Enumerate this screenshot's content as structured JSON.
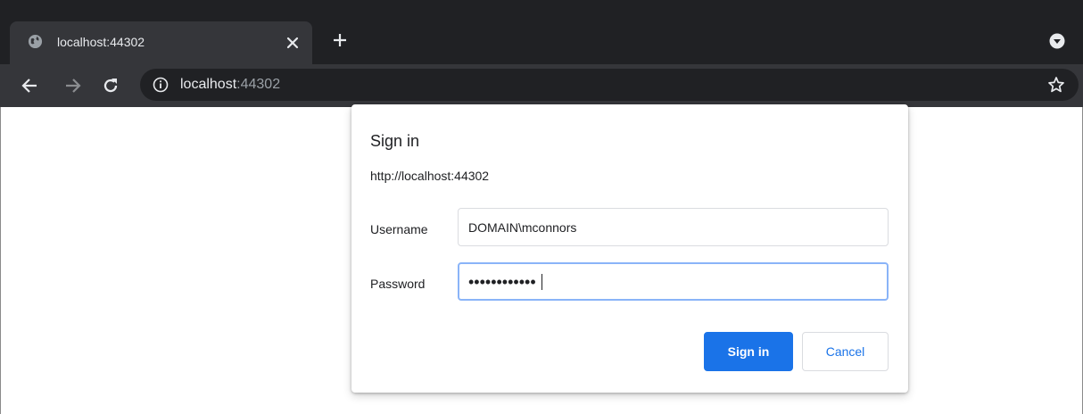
{
  "browser": {
    "tab": {
      "title": "localhost:44302"
    },
    "address_bar": {
      "host": "localhost",
      "port": ":44302"
    }
  },
  "dialog": {
    "title": "Sign in",
    "origin": "http://localhost:44302",
    "username": {
      "label": "Username",
      "value": "DOMAIN\\mconnors"
    },
    "password": {
      "label": "Password",
      "masked_value": "••••••••••••"
    },
    "buttons": {
      "sign_in": "Sign in",
      "cancel": "Cancel"
    }
  },
  "colors": {
    "titlebar": "#202124",
    "toolbar": "#35363a",
    "primary_button": "#1a73e8",
    "focus_ring": "#8ab4f8"
  },
  "icons": [
    "globe-icon",
    "close-icon",
    "plus-icon",
    "profile-dropdown-icon",
    "back-arrow-icon",
    "forward-arrow-icon",
    "reload-icon",
    "info-icon",
    "star-icon"
  ]
}
